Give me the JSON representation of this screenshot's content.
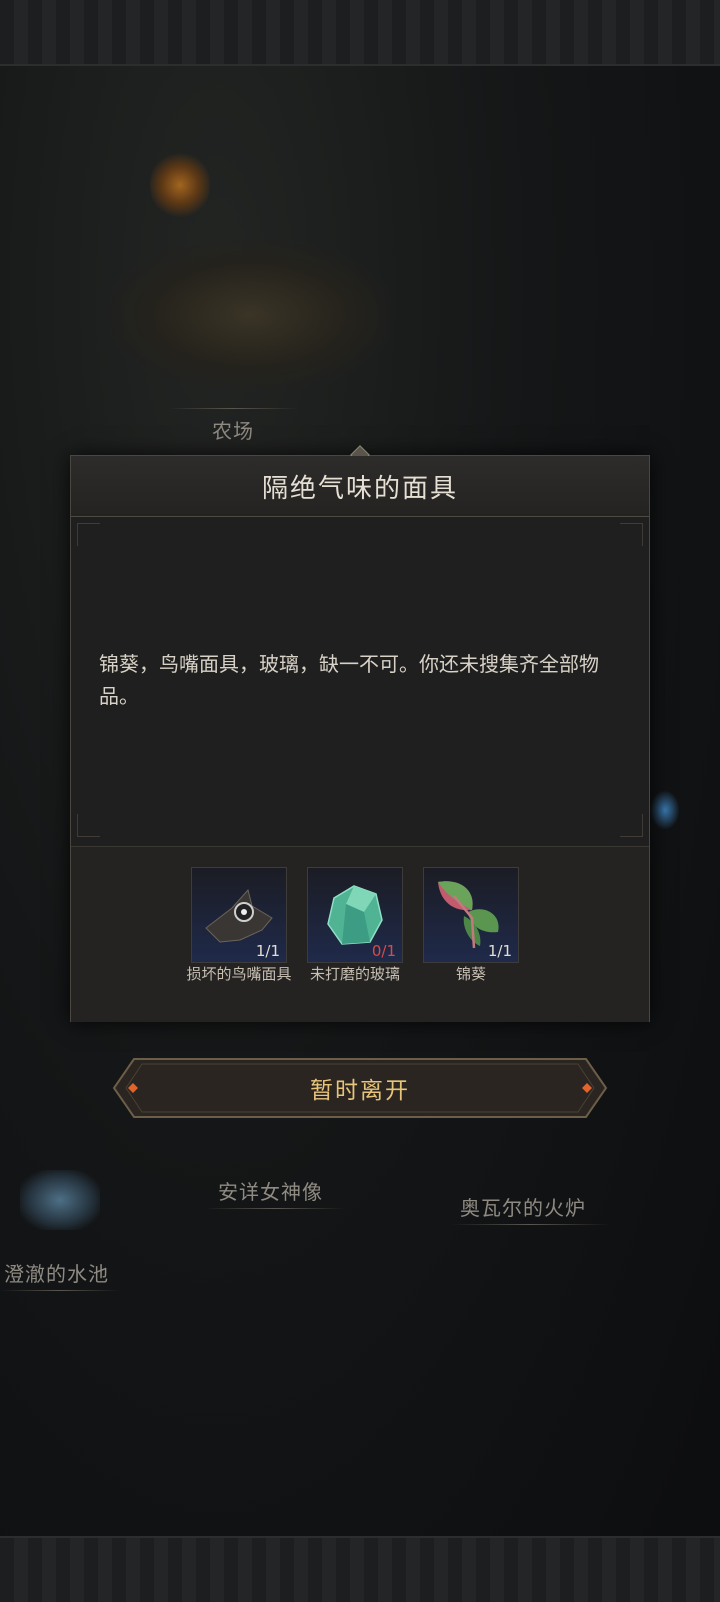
{
  "map": {
    "locations": [
      {
        "name": "农场"
      },
      {
        "name": "安详女神像"
      },
      {
        "name": "奥瓦尔的火炉"
      },
      {
        "name": "澄澈的水池"
      }
    ]
  },
  "dialog": {
    "title": "隔绝气味的面具",
    "message": "锦葵，鸟嘴面具，玻璃，缺一不可。你还未搜集齐全部物品。",
    "items": [
      {
        "name": "损坏的鸟嘴面具",
        "count": "1/1",
        "collected": true,
        "icon": "beak-mask-icon"
      },
      {
        "name": "未打磨的玻璃",
        "count": "0/1",
        "collected": false,
        "icon": "glass-crystal-icon"
      },
      {
        "name": "锦葵",
        "count": "1/1",
        "collected": true,
        "icon": "mallow-leaf-icon"
      }
    ]
  },
  "leave_button": {
    "label": "暂时离开"
  },
  "colors": {
    "missing_count": "#d94a4a",
    "button_text": "#e7c47a",
    "item_slot_blue": "#1f2a4a"
  }
}
